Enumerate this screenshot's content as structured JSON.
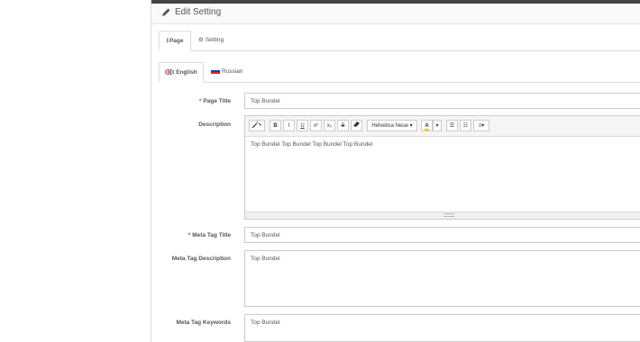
{
  "heading": {
    "title": "Edit Setting"
  },
  "tabs": [
    {
      "label": "Page",
      "icon": "info-icon"
    },
    {
      "label": "Setting",
      "icon": "gear-icon"
    }
  ],
  "language_tabs": [
    {
      "label": "English",
      "flag": "uk-flag-icon"
    },
    {
      "label": "Russian",
      "flag": "russia-flag-icon"
    }
  ],
  "form": {
    "page_title": {
      "label": "Page Title",
      "required_marker": "*",
      "value": "Top Bundel"
    },
    "description": {
      "label": "Description",
      "body": "Top Bundel Top Bundel Top Bundel Top Bundel",
      "toolbar": {
        "style": "",
        "bold": "B",
        "italic": "I",
        "underline": "U",
        "superscript": "x²",
        "subscript": "x₂",
        "strikethrough": "S",
        "eraser": "",
        "font": "Helvetica Neue",
        "color": "A"
      }
    },
    "meta_title": {
      "label": "Meta Tag Title",
      "required_marker": "*",
      "value": "Top Bundel"
    },
    "meta_description": {
      "label": "Meta Tag Description",
      "value": "Top Bundel"
    },
    "meta_keywords": {
      "label": "Meta Tag Keywords",
      "value": "Top Bundel"
    }
  },
  "colors": {
    "required": "#e0433a",
    "border": "#cccccc"
  }
}
